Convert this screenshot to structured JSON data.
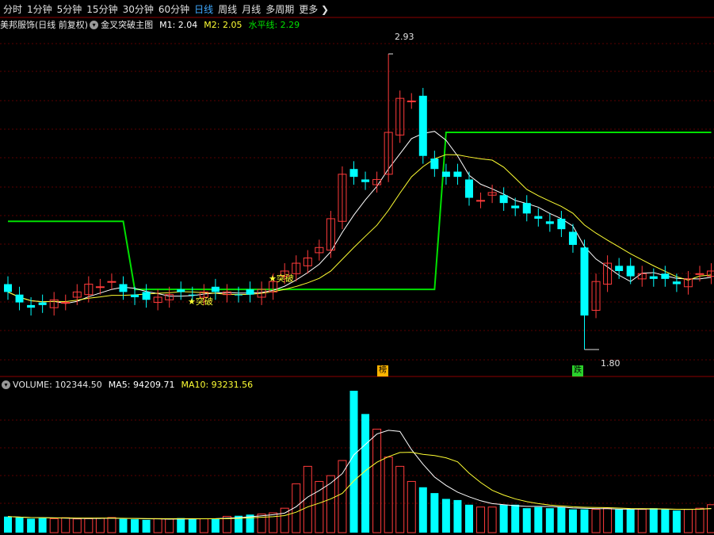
{
  "tabs": [
    {
      "label": "分时",
      "active": false
    },
    {
      "label": "1分钟",
      "active": false
    },
    {
      "label": "5分钟",
      "active": false
    },
    {
      "label": "15分钟",
      "active": false
    },
    {
      "label": "30分钟",
      "active": false
    },
    {
      "label": "60分钟",
      "active": false
    },
    {
      "label": "日线",
      "active": true
    },
    {
      "label": "周线",
      "active": false
    },
    {
      "label": "月线",
      "active": false
    },
    {
      "label": "多周期",
      "active": false
    }
  ],
  "more_label": "更多",
  "main_panel": {
    "stock_title": "美邦服饰(日线 前复权)",
    "indicator_name": "金叉突破主图",
    "m1": "M1: 2.04",
    "m2": "M2: 2.05",
    "level": "水平线: 2.29",
    "high_label": "2.93",
    "low_label": "1.80",
    "signal_label": "★突破",
    "badge_top": "榜",
    "badge_down": "跌"
  },
  "volume_panel": {
    "volume": "VOLUME: 102344.50",
    "ma5": "MA5: 94209.71",
    "ma10": "MA10: 93231.56"
  },
  "colors": {
    "up": "#ff3b3b",
    "down": "#00ffff",
    "ma_fast": "#ffffff",
    "ma_slow": "#ffff33",
    "level_line": "#00e000",
    "grid": "#5a0000",
    "active_tab": "#3fa9ff"
  },
  "chart_data": {
    "type": "candlestick",
    "date_labels_visible": false,
    "price_high_marker": 2.93,
    "price_low_marker": 1.8,
    "ohlc_close_approx": [
      2.02,
      1.98,
      1.96,
      1.97,
      1.99,
      1.98,
      2.02,
      2.05,
      2.04,
      2.06,
      2.02,
      2.0,
      1.99,
      2.0,
      2.01,
      2.02,
      2.01,
      2.02,
      2.02,
      2.02,
      2.01,
      2.01,
      2.03,
      2.06,
      2.1,
      2.13,
      2.15,
      2.19,
      2.3,
      2.47,
      2.46,
      2.44,
      2.45,
      2.63,
      2.76,
      2.75,
      2.54,
      2.49,
      2.46,
      2.46,
      2.38,
      2.37,
      2.4,
      2.36,
      2.34,
      2.32,
      2.3,
      2.28,
      2.26,
      2.2,
      1.93,
      2.06,
      2.13,
      2.1,
      2.08,
      2.09,
      2.07,
      2.07,
      2.05,
      2.07,
      2.09,
      2.1
    ],
    "volume_approx": [
      13800,
      13000,
      12000,
      12500,
      12000,
      12800,
      11800,
      12000,
      12500,
      13000,
      11800,
      11500,
      11000,
      12000,
      11800,
      12500,
      11600,
      11900,
      12300,
      14000,
      14500,
      15500,
      16000,
      17000,
      21000,
      42000,
      57000,
      44000,
      49000,
      62000,
      122000,
      102000,
      89000,
      65000,
      57000,
      44000,
      39000,
      34000,
      29000,
      28000,
      24000,
      22000,
      22000,
      24000,
      24000,
      21000,
      22000,
      21000,
      22000,
      20000,
      20000,
      20000,
      21000,
      20000,
      20000,
      20000,
      21000,
      20000,
      19000,
      20000,
      21000,
      24000
    ]
  }
}
